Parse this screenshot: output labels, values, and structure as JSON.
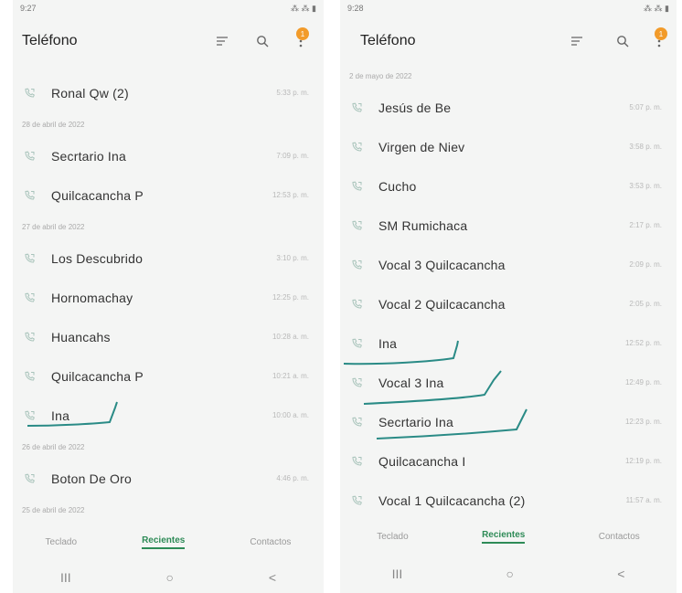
{
  "left": {
    "status": {
      "time": "9:27",
      "right": "⁂ ⁂ ▮"
    },
    "title": "Teléfono",
    "rows": [
      {
        "kind": "call",
        "name": "Ronal Qw (2)",
        "time": "5:33 p. m."
      },
      {
        "kind": "date",
        "label": "28 de abril de 2022"
      },
      {
        "kind": "call",
        "name": "Secrtario Ina",
        "time": "7:09 p. m."
      },
      {
        "kind": "call",
        "name": "Quilcacancha P",
        "time": "12:53 p. m."
      },
      {
        "kind": "date",
        "label": "27 de abril de 2022"
      },
      {
        "kind": "call",
        "name": "Los Descubrido",
        "time": "3:10 p. m."
      },
      {
        "kind": "call",
        "name": "Hornomachay",
        "time": "12:25 p. m."
      },
      {
        "kind": "call",
        "name": "Huancahs",
        "time": "10:28 a. m."
      },
      {
        "kind": "call",
        "name": "Quilcacancha P",
        "time": "10:21 a. m."
      },
      {
        "kind": "call",
        "name": "Ina",
        "time": "10:00 a. m."
      },
      {
        "kind": "date",
        "label": "26 de abril de 2022"
      },
      {
        "kind": "call",
        "name": "Boton De Oro",
        "time": "4:46 p. m."
      },
      {
        "kind": "date",
        "label": "25 de abril de 2022"
      }
    ],
    "tabs": [
      "Teclado",
      "Recientes",
      "Contactos"
    ],
    "nav": [
      "III",
      "○",
      "<"
    ]
  },
  "right": {
    "status": {
      "time": "9:28",
      "right": "⁂ ⁂ ▮"
    },
    "title": "Teléfono",
    "rows": [
      {
        "kind": "date",
        "label": "2 de mayo de 2022"
      },
      {
        "kind": "call",
        "name": "Jesús de Be",
        "time": "5:07 p. m."
      },
      {
        "kind": "call",
        "name": "Virgen de Niev",
        "time": "3:58 p. m."
      },
      {
        "kind": "call",
        "name": "Cucho",
        "time": "3:53 p. m."
      },
      {
        "kind": "call",
        "name": "SM Rumichaca",
        "time": "2:17 p. m."
      },
      {
        "kind": "call",
        "name": "Vocal 3 Quilcacancha",
        "time": "2:09 p. m."
      },
      {
        "kind": "call",
        "name": "Vocal 2 Quilcacancha",
        "time": "2:05 p. m."
      },
      {
        "kind": "call",
        "name": "Ina",
        "time": "12:52 p. m."
      },
      {
        "kind": "call",
        "name": "Vocal 3 Ina",
        "time": "12:49 p. m."
      },
      {
        "kind": "call",
        "name": "Secrtario Ina",
        "time": "12:23 p. m."
      },
      {
        "kind": "call",
        "name": "Quilcacancha I",
        "time": "12:19 p. m."
      },
      {
        "kind": "call",
        "name": "Vocal 1 Quilcacancha (2)",
        "time": "11:57 a. m."
      }
    ],
    "tabs": [
      "Teclado",
      "Recientes",
      "Contactos"
    ],
    "nav": [
      "III",
      "○",
      "<"
    ]
  },
  "badge_count": "1",
  "colors": {
    "accent": "#2e8b57",
    "scribble": "#2a8b86",
    "badge": "#f29b2a"
  },
  "icons": {
    "filter": "filter-icon",
    "search": "search-icon",
    "more": "more-vert-icon",
    "call": "call-icon"
  }
}
